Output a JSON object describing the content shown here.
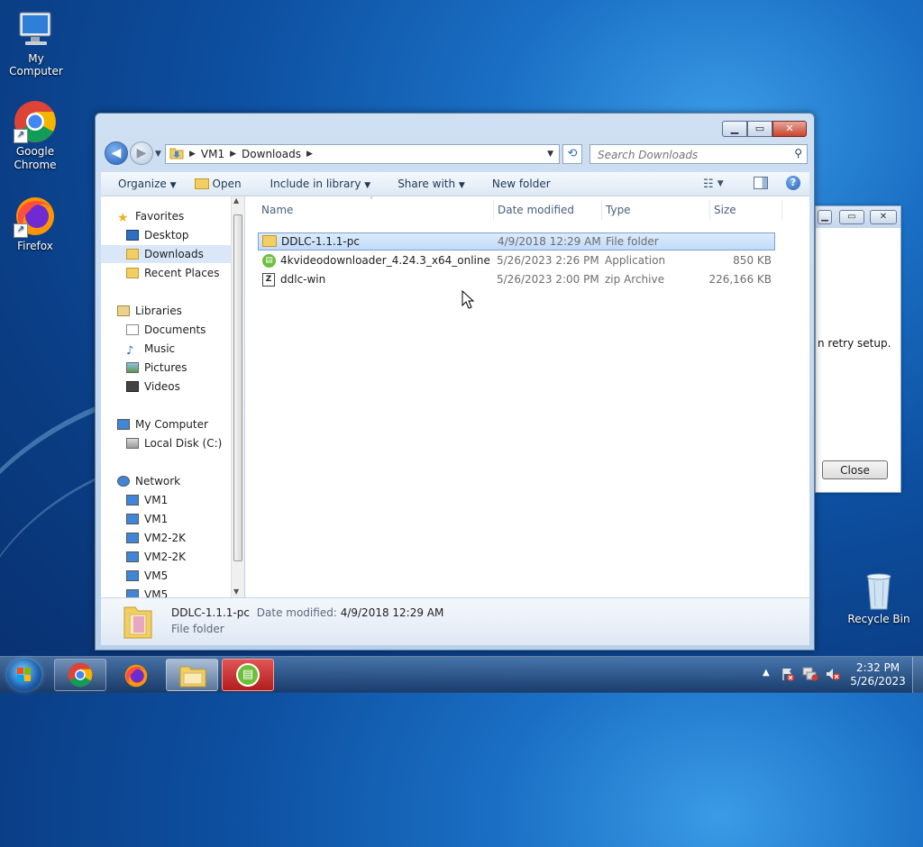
{
  "desktop": {
    "icons": [
      {
        "label": "My Computer"
      },
      {
        "label": "Google Chrome"
      },
      {
        "label": "Firefox"
      },
      {
        "label": "Recycle Bin"
      }
    ]
  },
  "background_dialog": {
    "message": "n retry setup.",
    "close_label": "Close"
  },
  "explorer": {
    "breadcrumb": [
      "VM1",
      "Downloads"
    ],
    "search_placeholder": "Search Downloads",
    "commands": {
      "organize": "Organize",
      "open": "Open",
      "include": "Include in library",
      "share": "Share with",
      "new_folder": "New folder"
    },
    "nav": {
      "favorites": "Favorites",
      "desktop": "Desktop",
      "downloads": "Downloads",
      "recent": "Recent Places",
      "libraries": "Libraries",
      "documents": "Documents",
      "music": "Music",
      "pictures": "Pictures",
      "videos": "Videos",
      "computer": "My Computer",
      "local_disk": "Local Disk (C:)",
      "network": "Network",
      "net_items": [
        "VM1",
        "VM1",
        "VM2-2K",
        "VM2-2K",
        "VM5",
        "VM5"
      ]
    },
    "columns": {
      "name": "Name",
      "date": "Date modified",
      "type": "Type",
      "size": "Size"
    },
    "files": [
      {
        "name": "DDLC-1.1.1-pc",
        "date": "4/9/2018 12:29 AM",
        "type": "File folder",
        "size": "",
        "icon": "folder-icon",
        "selected": true
      },
      {
        "name": "4kvideodownloader_4.24.3_x64_online",
        "date": "5/26/2023 2:26 PM",
        "type": "Application",
        "size": "850 KB",
        "icon": "app-icon",
        "selected": false
      },
      {
        "name": "ddlc-win",
        "date": "5/26/2023 2:00 PM",
        "type": "zip Archive",
        "size": "226,166 KB",
        "icon": "zip-icon",
        "selected": false
      }
    ],
    "details_pane": {
      "name": "DDLC-1.1.1-pc",
      "date_label": "Date modified:",
      "date": "4/9/2018 12:29 AM",
      "type": "File folder"
    }
  },
  "taskbar": {
    "time": "2:32 PM",
    "date": "5/26/2023"
  }
}
